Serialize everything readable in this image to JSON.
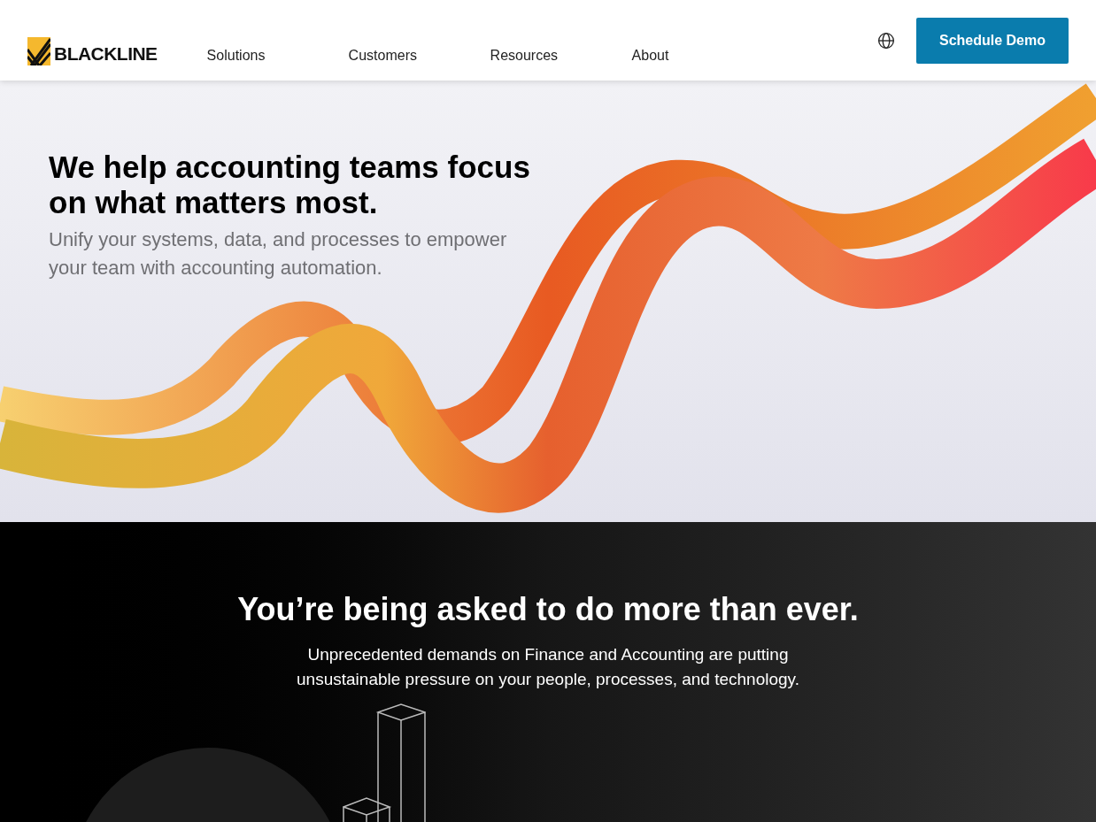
{
  "header": {
    "logo_text": "BLACKLINE",
    "nav": [
      {
        "label": "Solutions"
      },
      {
        "label": "Customers"
      },
      {
        "label": "Resources"
      },
      {
        "label": "About"
      }
    ],
    "cta": "Schedule Demo"
  },
  "hero": {
    "title": "We help accounting teams focus on what matters most.",
    "subtitle": "Unify your systems, data, and processes to empower your team with accounting automation."
  },
  "section": {
    "title": "You’re being asked to do more than ever.",
    "body": "Unprecedented demands on Finance and Accounting are putting unsustainable pressure on your people, processes, and technology."
  }
}
